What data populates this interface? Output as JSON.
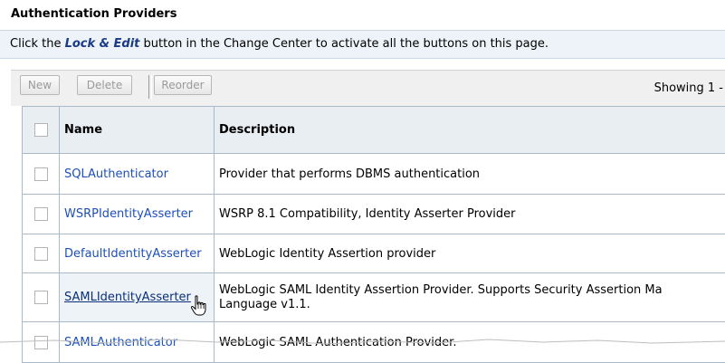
{
  "page": {
    "section_title": "Authentication Providers",
    "info": {
      "prefix": "Click the ",
      "lock_edit": "Lock & Edit",
      "suffix": " button in the Change Center to activate all the buttons on this page."
    }
  },
  "toolbar": {
    "new_label": "New",
    "delete_label": "Delete",
    "reorder_label": "Reorder",
    "showing": "Showing 1 -"
  },
  "table": {
    "headers": [
      "Name",
      "Description"
    ],
    "rows": [
      {
        "name": "SQLAuthenticator",
        "description": "Provider that performs DBMS authentication"
      },
      {
        "name": "WSRPIdentityAsserter",
        "description": "WSRP 8.1 Compatibility, Identity Asserter Provider"
      },
      {
        "name": "DefaultIdentityAsserter",
        "description": "WebLogic Identity Assertion provider"
      },
      {
        "name": "SAMLIdentityAsserter",
        "description": "WebLogic SAML Identity Assertion Provider. Supports Security Assertion Ma",
        "description_line2": "Language v1.1."
      },
      {
        "name": "SAMLAuthenticator",
        "description": "WebLogic SAML Authentication Provider."
      }
    ]
  },
  "colors": {
    "link": "#1d4fb8",
    "lock_edit": "#1a3a86",
    "info_bar_bg": "#edf3f8",
    "header_bg": "#e9eef3",
    "border": "#a9b9c9"
  },
  "icons": {
    "cursor": "hand-pointer-icon"
  }
}
